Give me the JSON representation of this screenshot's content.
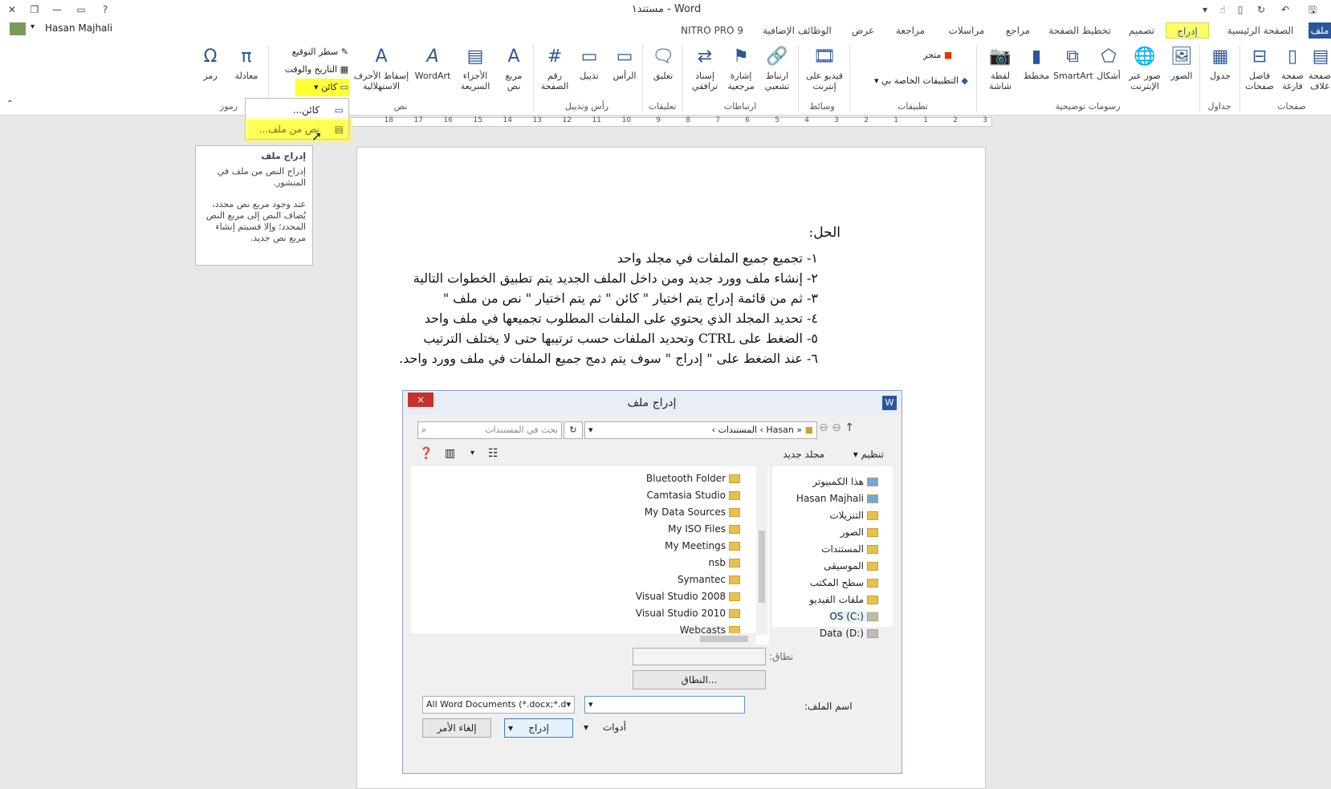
{
  "window": {
    "title": "مستند١ - Word",
    "help": "?"
  },
  "user": {
    "name": "Hasan Majhali"
  },
  "tabs": [
    {
      "label": "ملف",
      "active": false
    },
    {
      "label": "الصفحة الرئيسية",
      "active": false
    },
    {
      "label": "إدراج",
      "active": true
    },
    {
      "label": "تصميم",
      "active": false
    },
    {
      "label": "تخطيط الصفحة",
      "active": false
    },
    {
      "label": "مراجع",
      "active": false
    },
    {
      "label": "مراسلات",
      "active": false
    },
    {
      "label": "مراجعة",
      "active": false
    },
    {
      "label": "عرض",
      "active": false
    },
    {
      "label": "الوظائف الإضافية",
      "active": false
    },
    {
      "label": "NITRO PRO 9",
      "active": false
    }
  ],
  "ribbon": {
    "groups": [
      "صفحات",
      "جداول",
      "رسومات توضيحية",
      "تطبيقات",
      "وسائط",
      "ارتباطات",
      "تعليقات",
      "رأس وتذييل",
      "نص",
      "رموز"
    ],
    "buttons": {
      "cover": "صفحة غلاف",
      "blank": "صفحة فارغة",
      "break": "فاصل صفحات",
      "table": "جدول",
      "pictures": "الصور",
      "online_pictures": "صور عبر الإنترنت",
      "shapes": "أشكال",
      "smartart": "SmartArt",
      "chart": "مخطط",
      "screenshot": "لقطة شاشة",
      "store": "متجر",
      "my_apps": "التطبيقات الخاصة بي",
      "video": "فيديو على إنترنت",
      "hyperlink": "ارتباط تشعبي",
      "bookmark": "إشارة مرجعية",
      "crossref": "إسناد ترافقي",
      "comment": "تعليق",
      "header": "الرأس",
      "footer": "تذييل",
      "pagenum": "رقم الصفحة",
      "textbox": "مربع نص",
      "quickparts": "الأجزاء السريعة",
      "wordart": "WordArt",
      "dropcap": "إسقاط الأحرف الاستهلالية",
      "signature": "سطر التوقيع",
      "datetime": "التاريخ والوقت",
      "object": "كائن",
      "equation": "معادلة",
      "symbol": "رمز"
    }
  },
  "ruler": {
    "numbers": [
      "3",
      "2",
      "1",
      "1",
      "2",
      "3",
      "4",
      "5",
      "6",
      "7",
      "8",
      "9",
      "10",
      "11",
      "12",
      "13",
      "14",
      "15",
      "16",
      "17",
      "18"
    ]
  },
  "object_menu": {
    "item1": "كائن...",
    "item2": "نص من ملف..."
  },
  "tooltip": {
    "title": "إدراج ملف",
    "line1": "إدراج النص من ملف في المنشور.",
    "line2": "عند وجود مربع نص محدد، يُضاف النص إلى مربع النص المحدد؛ وإلا فسيتم إنشاء مربع نص جديد."
  },
  "document": {
    "heading": "الحل:",
    "lines": [
      "١- تجميع جميع الملفات في مجلد واحد",
      "٢- إنشاء ملف وورد جديد ومن داخل الملف الجديد يتم تطبيق الخطوات التالية",
      "٣- ثم من قائمة إدراج يتم اختيار \" كائن \" ثم يتم اختيار \" نص من ملف \"",
      "٤- تحديد المجلد الذي يحتوي على الملفات المطلوب تجميعها في ملف واحد",
      "٥- الضغط على CTRL وتحديد الملفات حسب ترتيبها حتى لا يختلف الترتيب",
      "٦- عند الضغط على \" إدراج \" سوف يتم دمج جميع الملفات في ملف وورد واحد."
    ]
  },
  "dialog": {
    "title": "إدراج ملف",
    "close": "×",
    "breadcrumb": [
      "Hasan",
      "المستندات"
    ],
    "search_placeholder": "بحث في المستندات",
    "organize": "تنظيم",
    "new_folder": "مجلد جديد",
    "nav_items": [
      "هذا الكمبيوتر",
      "Hasan Majhali",
      "التنزيلات",
      "الصور",
      "المستندات",
      "الموسيقى",
      "سطح المكتب",
      "ملفات الفيديو",
      "OS (C:)",
      "Data (D:)"
    ],
    "files": [
      "Bluetooth Folder",
      "Camtasia Studio",
      "My Data Sources",
      "My ISO Files",
      "My Meetings",
      "nsb",
      "Symantec",
      "Visual Studio 2008",
      "Visual Studio 2010",
      "Webcasts"
    ],
    "range_label": "نطاق:",
    "range_button": "النطاق...",
    "filename_label": "اسم الملف:",
    "filetype": "All Word Documents (*.docx;*.d",
    "tools": "أدوات",
    "insert": "إدراج",
    "cancel": "إلغاء الأمر"
  },
  "colors": {
    "accent": "#2b579a",
    "highlight": "#ffff66",
    "close_red": "#c7312a"
  }
}
